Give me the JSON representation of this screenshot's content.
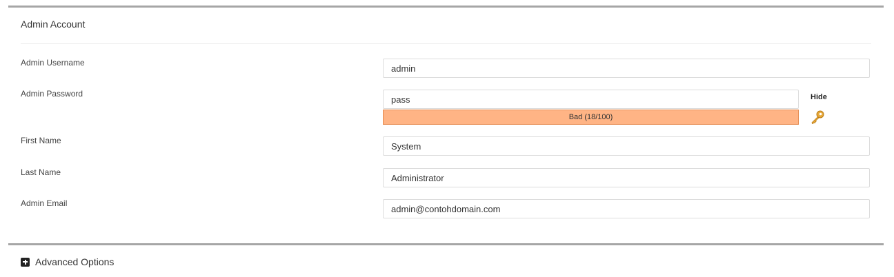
{
  "admin_account": {
    "title": "Admin Account",
    "fields": {
      "username": {
        "label": "Admin Username",
        "value": "admin"
      },
      "password": {
        "label": "Admin Password",
        "value": "pass"
      },
      "first_name": {
        "label": "First Name",
        "value": "System"
      },
      "last_name": {
        "label": "Last Name",
        "value": "Administrator"
      },
      "email": {
        "label": "Admin Email",
        "value": "admin@contohdomain.com"
      }
    },
    "password_strength": {
      "text": "Bad (18/100)",
      "score": 18,
      "color": "#ffb485"
    },
    "hide_label": "Hide",
    "generate_icon": "key-icon"
  },
  "advanced": {
    "label": "Advanced Options",
    "icon": "plus-square-icon"
  }
}
